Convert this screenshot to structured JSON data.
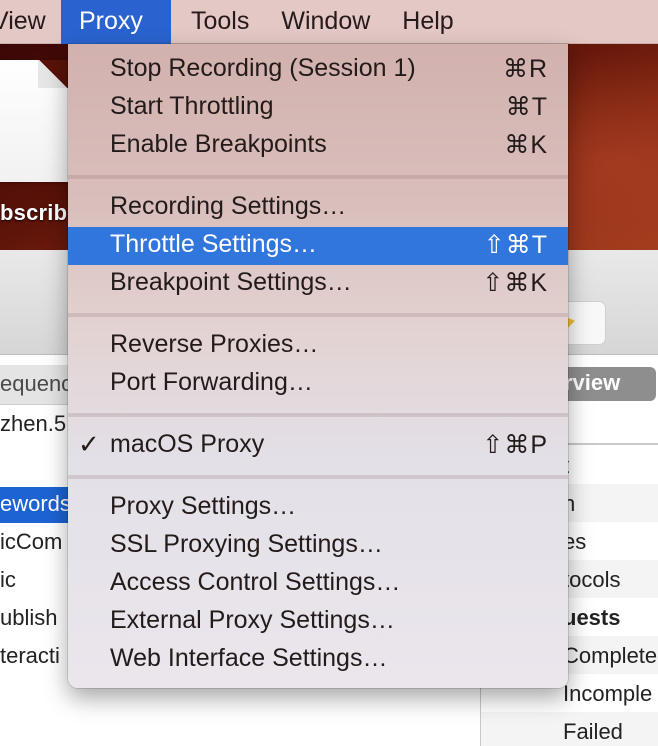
{
  "menubar": {
    "items": [
      {
        "label": "View",
        "active": false
      },
      {
        "label": "Proxy",
        "active": true
      },
      {
        "label": "Tools",
        "active": false
      },
      {
        "label": "Window",
        "active": false
      },
      {
        "label": "Help",
        "active": false
      }
    ]
  },
  "desktop": {
    "file_label": "bscrib"
  },
  "proxy_menu": {
    "groups": [
      [
        {
          "label": "Stop Recording (Session 1)",
          "shortcut": "⌘R"
        },
        {
          "label": "Start Throttling",
          "shortcut": "⌘T"
        },
        {
          "label": "Enable Breakpoints",
          "shortcut": "⌘K"
        }
      ],
      [
        {
          "label": "Recording Settings…",
          "shortcut": ""
        },
        {
          "label": "Throttle Settings…",
          "shortcut": "⇧⌘T",
          "highlighted": true
        },
        {
          "label": "Breakpoint Settings…",
          "shortcut": "⇧⌘K"
        }
      ],
      [
        {
          "label": "Reverse Proxies…",
          "shortcut": ""
        },
        {
          "label": "Port Forwarding…",
          "shortcut": ""
        }
      ],
      [
        {
          "label": "macOS Proxy",
          "shortcut": "⇧⌘P",
          "checked": true,
          "check_mark": "✓"
        }
      ],
      [
        {
          "label": "Proxy Settings…",
          "shortcut": ""
        },
        {
          "label": "SSL Proxying Settings…",
          "shortcut": ""
        },
        {
          "label": "Access Control Settings…",
          "shortcut": ""
        },
        {
          "label": "External Proxy Settings…",
          "shortcut": ""
        },
        {
          "label": "Web Interface Settings…",
          "shortcut": ""
        }
      ]
    ]
  },
  "left_panel": {
    "column_header": "equenc",
    "rows": [
      {
        "label": "zhen.5",
        "selected": false
      },
      {
        "label": "",
        "selected": false
      },
      {
        "label": "ewords",
        "selected": true
      },
      {
        "label": "icCom",
        "selected": false
      },
      {
        "label": "ic",
        "selected": false
      },
      {
        "label": "ublish",
        "selected": false
      },
      {
        "label": "teracti",
        "selected": false
      }
    ]
  },
  "right_panel": {
    "tab_label": "rview",
    "rows": [
      {
        "label": "t",
        "bold": false
      },
      {
        "label": "n",
        "bold": false
      },
      {
        "label": "es",
        "bold": false
      },
      {
        "label": "tocols",
        "bold": false
      },
      {
        "label": "uests",
        "bold": true
      },
      {
        "label": "Complete",
        "bold": false
      },
      {
        "label": "Incomple",
        "bold": false
      },
      {
        "label": "Failed",
        "bold": false
      }
    ]
  },
  "colors": {
    "menu_highlight": "#3176dc",
    "menubar_active": "#2a63cf",
    "selection_blue": "#1d63d3"
  }
}
